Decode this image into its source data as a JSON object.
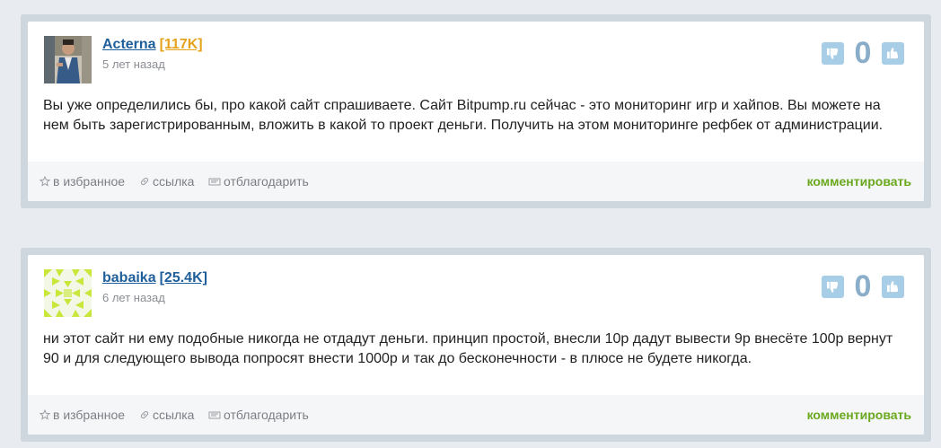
{
  "colors": {
    "username": "#1f5f9b",
    "rep_gold": "#e5a21b",
    "rep_blue": "#1f5f9b",
    "vote_button": "#a8cde6",
    "score": "#8aaec9",
    "comment_link": "#6aa81e"
  },
  "posts": [
    {
      "username": "Acterna",
      "reputation": "[117K]",
      "time_ago": "5 лет назад",
      "score": "0",
      "text": "Вы уже определились бы, про какой сайт спрашиваете. Сайт Bitpump.ru сейчас - это мониторинг игр и хайпов. Вы можете на нем быть зарегистрированным, вложить в какой то проект деньги. Получить на этом мониторинге рефбек от администрации.",
      "actions": {
        "favorite": "в избранное",
        "link": "ссылка",
        "thank": "отблагодарить",
        "comment": "комментировать"
      }
    },
    {
      "username": "babaika",
      "reputation": "[25.4K]",
      "time_ago": "6 лет назад",
      "score": "0",
      "text": "ни этот сайт ни ему подобные никогда не отдадут деньги. принцип простой, внесли 10р дадут вывести 9р внесёте 100р вернут 90 и для следующего вывода попросят внести 1000р и так до бесконечности - в плюсе не будете никогда.",
      "actions": {
        "favorite": "в избранное",
        "link": "ссылка",
        "thank": "отблагодарить",
        "comment": "комментировать"
      }
    }
  ]
}
